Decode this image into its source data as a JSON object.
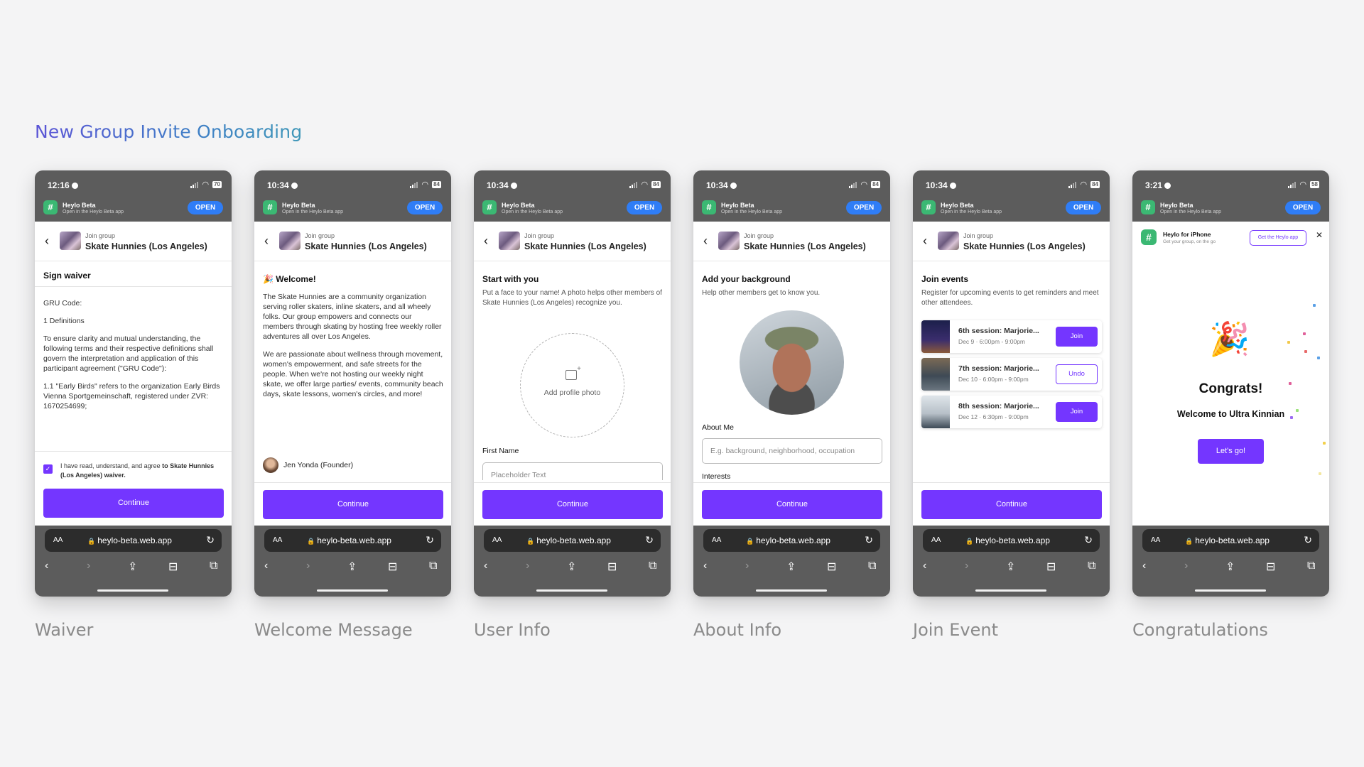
{
  "page": {
    "title": "New Group Invite Onboarding"
  },
  "common": {
    "banner_name": "Heylo Beta",
    "banner_sub": "Open in the Heylo Beta app",
    "open_label": "OPEN",
    "group_sub": "Join group",
    "group_name": "Skate Hunnies (Los Angeles)",
    "continue_label": "Continue",
    "url": "heylo-beta.web.app",
    "aa_label": "AA"
  },
  "screens": [
    {
      "caption": "Waiver",
      "time": "12:16",
      "battery": "70"
    },
    {
      "caption": "Welcome Message",
      "time": "10:34",
      "battery": "84"
    },
    {
      "caption": "User Info",
      "time": "10:34",
      "battery": "84"
    },
    {
      "caption": "About Info",
      "time": "10:34",
      "battery": "84"
    },
    {
      "caption": "Join Event",
      "time": "10:34",
      "battery": "84"
    },
    {
      "caption": "Congratulations",
      "time": "3:21",
      "battery": "58"
    }
  ],
  "waiver": {
    "title": "Sign waiver",
    "paragraphs": [
      "GRU Code:",
      "1 Definitions",
      "To ensure clarity and mutual understanding, the following terms and their respective definitions shall govern the interpretation and application of this participant agreement (\"GRU Code\"):",
      "1.1 \"Early Birds\" refers to the organization Early Birds Vienna Sportgemeinschaft, registered under ZVR: 1670254699;"
    ],
    "agree_prefix": "I have read, understand, and agree ",
    "agree_bold": "to Skate Hunnies (Los Angeles) waiver."
  },
  "welcome": {
    "emoji": "🎉",
    "title": "Welcome!",
    "paragraphs": [
      "The Skate Hunnies are a community organization serving roller skaters, inline skaters, and all wheely folks. Our group empowers and connects our members through skating by hosting free weekly roller adventures all over Los Angeles.",
      "We are passionate about wellness through movement, women's empowerment, and safe streets for the people. When we're not hosting our weekly night skate, we offer large parties/ events, community beach days, skate lessons, women's circles, and more!"
    ],
    "founder": "Jen Yonda (Founder)"
  },
  "user_info": {
    "title": "Start with you",
    "subtitle": "Put a face to your name! A photo helps other members of Skate Hunnies (Los Angeles) recognize you.",
    "photo_label": "Add profile photo",
    "first_name_label": "First Name",
    "first_name_placeholder": "Placeholder Text"
  },
  "about": {
    "title": "Add your background",
    "subtitle": "Help other members get to know you.",
    "about_label": "About Me",
    "about_placeholder": "E.g. background, neighborhood, occupation",
    "interests_label": "Interests"
  },
  "events": {
    "title": "Join events",
    "subtitle": "Register for upcoming events to get reminders and meet other attendees.",
    "items": [
      {
        "name": "6th session: Marjorie...",
        "date": "Dec 9 · 6:00pm - 9:00pm",
        "action": "Join"
      },
      {
        "name": "7th session: Marjorie...",
        "date": "Dec 10 · 6:00pm - 9:00pm",
        "action": "Undo"
      },
      {
        "name": "8th session: Marjorie...",
        "date": "Dec 12 · 6:30pm - 9:00pm",
        "action": "Join"
      }
    ]
  },
  "congrats": {
    "app_name": "Heylo for iPhone",
    "app_sub": "Get your group, on the go",
    "get_app": "Get the Heylo app",
    "title": "Congrats!",
    "subtitle": "Welcome to Ultra Kinnian",
    "button": "Let's go!"
  },
  "colors": {
    "accent": "#7436ff",
    "open_button": "#2f7df6",
    "heylo_green": "#3bb873"
  },
  "icons": [
    "moon-icon",
    "signal-icon",
    "wifi-icon",
    "battery-icon",
    "chevron-left-icon",
    "lock-icon",
    "reload-icon",
    "back-icon",
    "forward-icon",
    "share-icon",
    "bookmarks-icon",
    "tabs-icon",
    "add-photo-icon",
    "close-icon",
    "party-popper-icon"
  ]
}
